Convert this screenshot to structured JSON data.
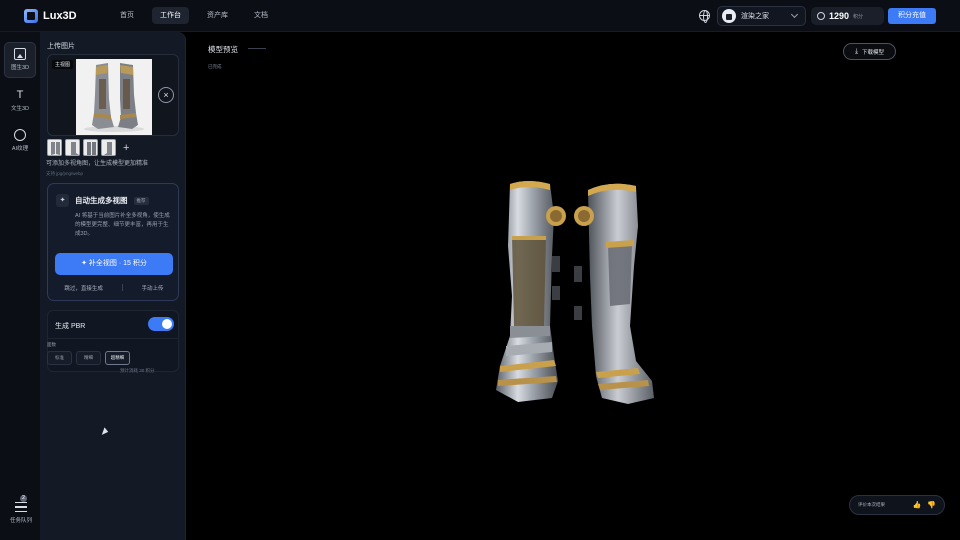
{
  "app": {
    "logo": "Lux3D"
  },
  "nav": [
    {
      "label": "首页"
    },
    {
      "label": "工作台"
    },
    {
      "label": "资产库"
    },
    {
      "label": "文档"
    }
  ],
  "header": {
    "user_name": "渲染之家",
    "credits": "1290",
    "credits_unit": "积分",
    "recharge_label": "积分充值"
  },
  "rail": [
    {
      "label": "图生3D",
      "icon": "image-icon"
    },
    {
      "label": "文生3D",
      "icon": "text-icon"
    },
    {
      "label": "AI纹理",
      "icon": "palette-icon"
    }
  ],
  "tasks": {
    "label": "任务队列",
    "badge": "2"
  },
  "panel": {
    "title": "上传图片",
    "main_tag": "主视图",
    "hint": "可添加多视角图，让生成模型更加精准",
    "format": "支持 jpg/png/webp",
    "multiview": {
      "title": "自动生成多视图",
      "badge": "推荐",
      "description": "AI 将基于当前图片补全多视角，使生成的模型更完整、细节更丰富，再用于生成3D。",
      "button_label": "✦ 补全视图 · 15 积分",
      "link_left": "跳过，直接生成",
      "link_right": "手动上传"
    },
    "pbr": {
      "label": "生成 PBR",
      "quality_label": "面数",
      "options": [
        "标准",
        "精细",
        "超精细"
      ],
      "note": "预计消耗 30 积分"
    }
  },
  "viewport": {
    "title": "模型预览",
    "subtitle": "已完成",
    "download_label": "下载模型",
    "feedback_label": "评价本次结果"
  },
  "colors": {
    "accent": "#3c7bf5",
    "background": "#000000",
    "panel": "#141a25"
  }
}
